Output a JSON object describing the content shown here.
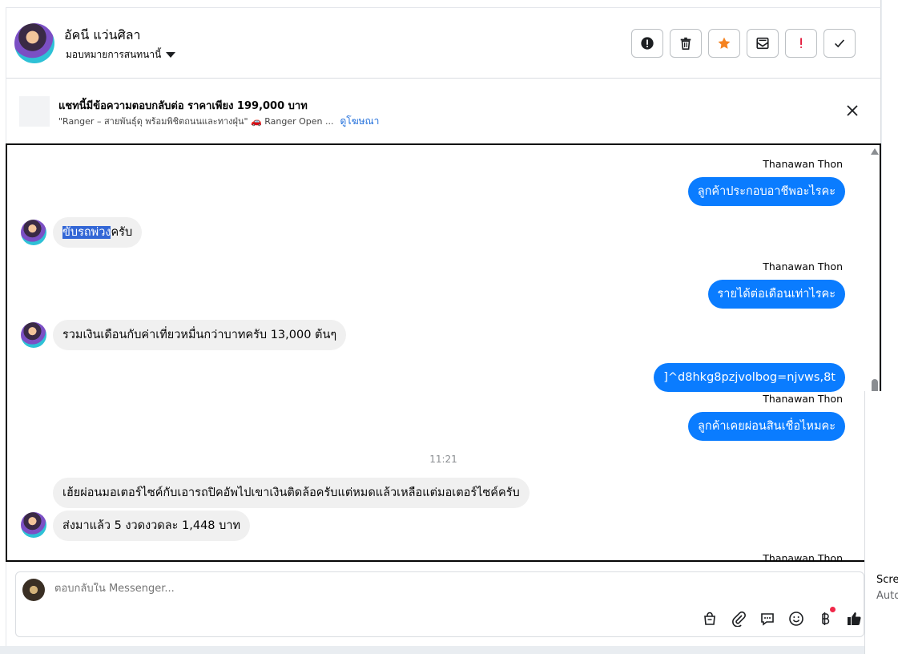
{
  "header": {
    "contact_name": "อัคนี แว่นศิลา",
    "assign_label": "มอบหมายการสนทนานี้",
    "actions": [
      {
        "name": "report-alert-button",
        "icon": "alert-circle-icon"
      },
      {
        "name": "delete-button",
        "icon": "trash-icon"
      },
      {
        "name": "star-button",
        "icon": "star-icon"
      },
      {
        "name": "mark-unread-button",
        "icon": "envelope-icon"
      },
      {
        "name": "follow-up-button",
        "icon": "exclamation-icon"
      },
      {
        "name": "mark-done-button",
        "icon": "check-icon"
      }
    ]
  },
  "ad": {
    "title": "แชทนี้มีข้อความตอบกลับต่อ ราคาเพียง 199,000 บาท",
    "subtitle": "\"Ranger – สายพันธุ์ดุ พร้อมพิชิตถนนและทางฝุ่น\" 🚗 Ranger Open ...",
    "link": "ดูโฆษณา"
  },
  "messages": {
    "sender_name": "Thanawan Thon",
    "out_1": "ลูกค้าประกอบอาชีพอะไรคะ",
    "in_1_highlight": "ขับรถพ่วง",
    "in_1_rest": "ครับ",
    "out_2": "รายได้ต่อเดือนเท่าไรคะ",
    "in_2": "รวมเงินเดือนกับค่าเที่ยวหมื่นกว่าบาทครับ 13,000 ต้นๆ",
    "out_3": "]^d8hkg8pzjvolbog=njvws,8t",
    "out_4": "ลูกค้าเคยผ่อนสินเชื่อไหมคะ",
    "timestamp": "11:21",
    "in_3": "เฮ้ยผ่อนมอเตอร์ไซค์กับเอารถปิคอัพไปเขาเงินติดล้อครับแต่หมดแล้วเหลือแต่มอเตอร์ไซค์ครับ",
    "in_4": "ส่งมาแล้ว 5 งวดงวดละ 1,448 บาท",
    "sender_name_bottom": "Thanawan Thon"
  },
  "composer": {
    "placeholder": "ตอบกลับใน Messenger..."
  },
  "side": {
    "frag_1": "Scre",
    "frag_2": "Auto"
  },
  "colors": {
    "outgoing_bubble": "#0a7cff",
    "incoming_bubble": "#f0f0f0",
    "star": "#f5821f",
    "alert": "#e41e3f",
    "link": "#216fdb"
  }
}
